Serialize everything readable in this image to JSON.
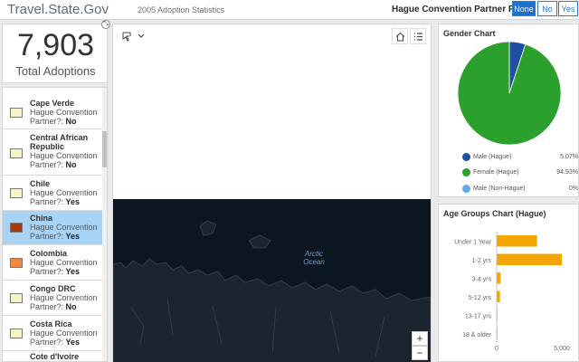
{
  "header": {
    "title": "Travel.State.Gov",
    "subtitle": "2005 Adoption Statistics",
    "filter_label": "Hague Convention Partner Filter",
    "filter_options": [
      "None",
      "No",
      "Yes"
    ],
    "filter_selected": "None",
    "accent_color": "#1e70cc"
  },
  "total": {
    "value": "7,903",
    "label": "Total Adoptions"
  },
  "country_list": {
    "items": [
      {
        "name": "Cape Verde",
        "detail": "Hague Convention Partner?:",
        "partner": "No",
        "swatch": "#f6f4c6",
        "selected": false
      },
      {
        "name": "Central African Republic",
        "detail": "Hague Convention Partner?:",
        "partner": "No",
        "swatch": "#f6f4c6",
        "selected": false
      },
      {
        "name": "Chile",
        "detail": "Hague Convention Partner?:",
        "partner": "Yes",
        "swatch": "#f6f4c6",
        "selected": false
      },
      {
        "name": "China",
        "detail": "Hague Convention Partner?:",
        "partner": "Yes",
        "swatch": "#a53a0c",
        "selected": true
      },
      {
        "name": "Colombia",
        "detail": "Hague Convention Partner?:",
        "partner": "Yes",
        "swatch": "#f08a3a",
        "selected": false
      },
      {
        "name": "Congo DRC",
        "detail": "Hague Convention Partner?:",
        "partner": "No",
        "swatch": "#f6f4c6",
        "selected": false
      },
      {
        "name": "Costa Rica",
        "detail": "Hague Convention Partner?:",
        "partner": "Yes",
        "swatch": "#f6f4c6",
        "selected": false
      },
      {
        "name": "Cote d'Ivoire",
        "detail": "",
        "partner": "",
        "swatch": "#f6f4c6",
        "selected": false
      }
    ]
  },
  "map": {
    "label_line1": "Arctic",
    "label_line2": "Ocean",
    "zoom_in": "+",
    "zoom_out": "−",
    "tool_icons": [
      "select-icon",
      "chevron-down-icon",
      "home-icon",
      "list-icon"
    ]
  },
  "gender_chart": {
    "title": "Gender Chart",
    "chart_data": {
      "type": "pie",
      "labels": [
        "Male (Hague)",
        "Female (Hague)",
        "Male (Non-Hague)"
      ],
      "values": [
        5.07,
        94.93,
        0
      ],
      "display_values": [
        "5.07%",
        "94.93%",
        "0%"
      ],
      "colors": [
        "#1f4fa0",
        "#2ca02c",
        "#63a7e8"
      ],
      "legend": "bottom"
    }
  },
  "age_chart": {
    "title": "Age Groups Chart (Hague)",
    "chart_data": {
      "type": "bar",
      "orientation": "horizontal",
      "categories": [
        "Under 1 Year",
        "1-2 yrs",
        "3-4 yrs",
        "5-12 yrs",
        "13-17 yrs",
        "18 & older"
      ],
      "values": [
        3100,
        5000,
        300,
        250,
        20,
        10
      ],
      "x_ticks": [
        "0",
        "5,000"
      ],
      "xlim": [
        0,
        5000
      ],
      "bar_color": "#f5a500"
    }
  }
}
